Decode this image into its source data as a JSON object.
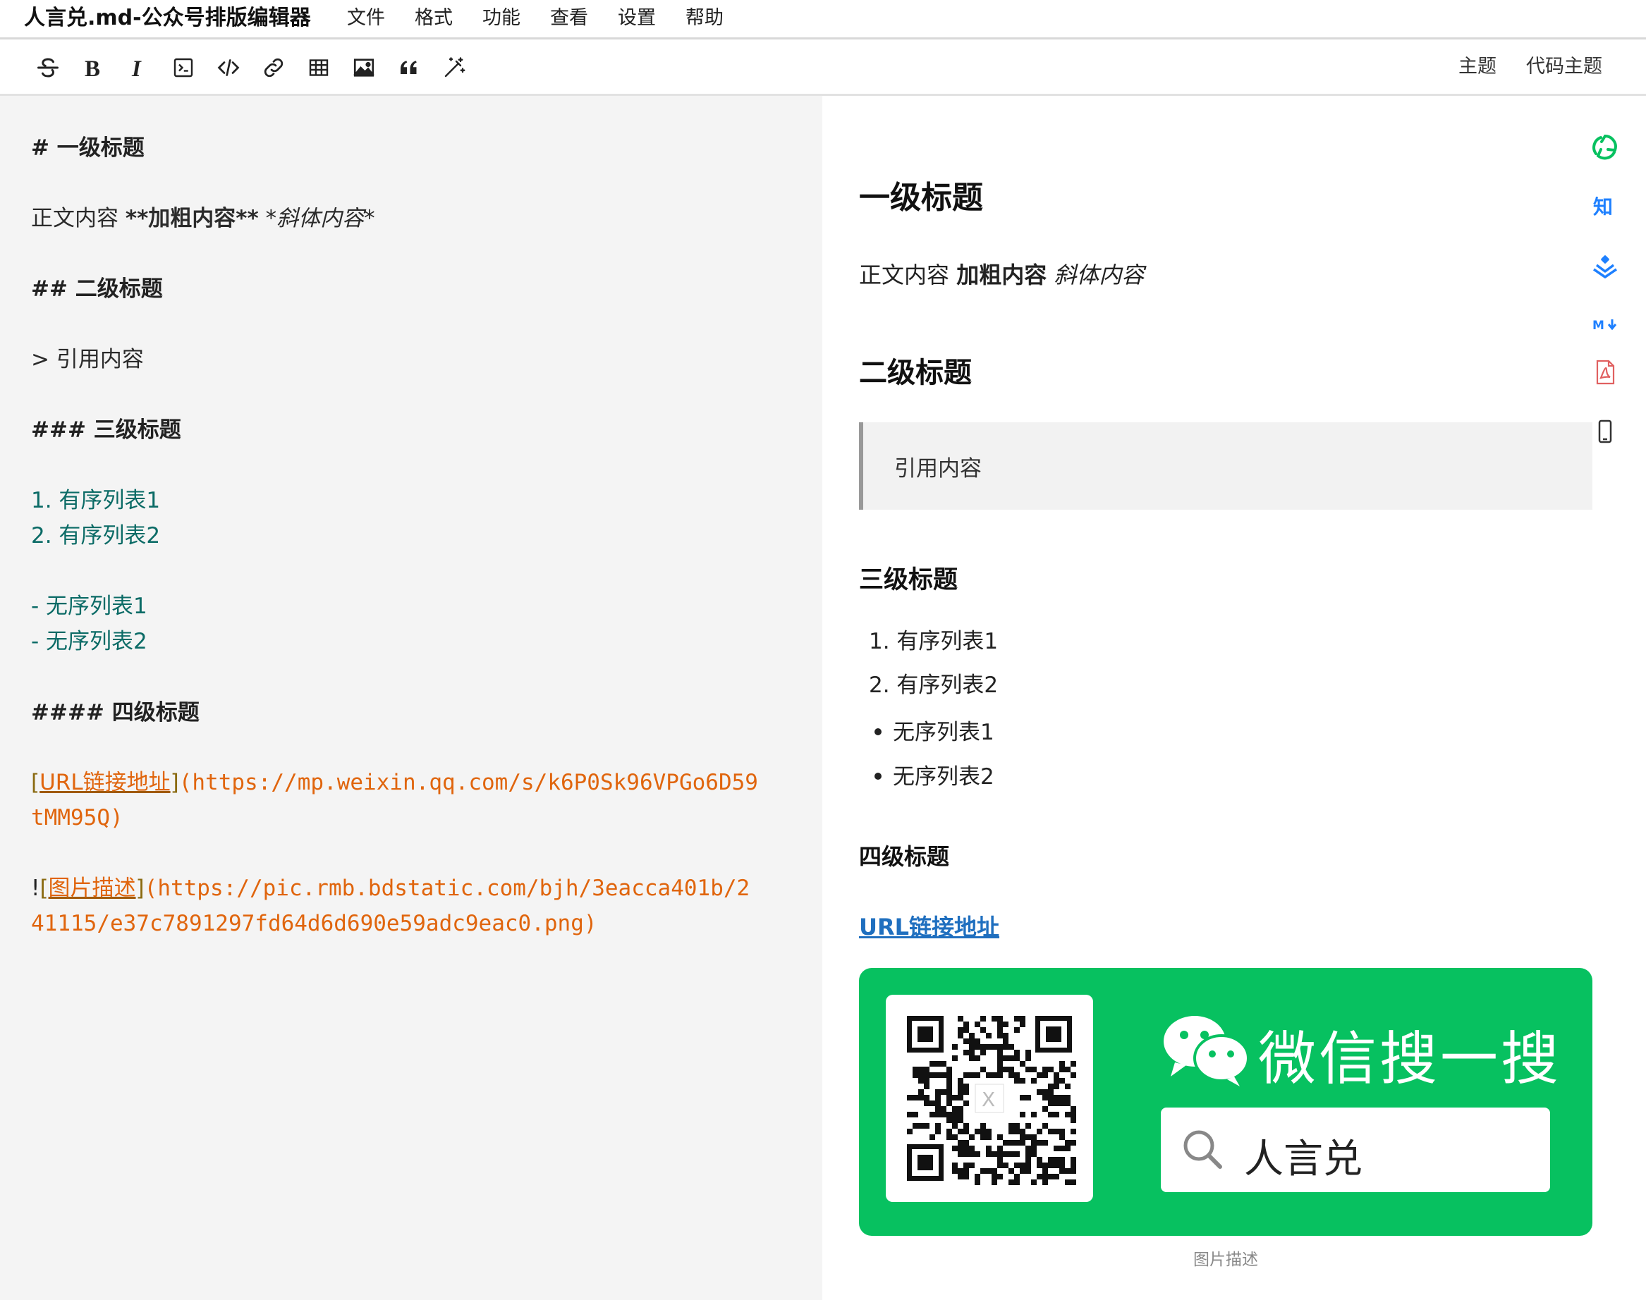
{
  "app": {
    "title": "人言兑.md-公众号排版编辑器"
  },
  "menu": {
    "items": [
      "文件",
      "格式",
      "功能",
      "查看",
      "设置",
      "帮助"
    ]
  },
  "toolbar": {
    "icons": [
      "strikethrough-icon",
      "bold-icon",
      "italic-icon",
      "inline-code-icon",
      "code-block-icon",
      "link-icon",
      "table-icon",
      "image-icon",
      "quote-icon",
      "magic-wand-icon"
    ],
    "theme_label": "主题",
    "code_theme_label": "代码主题"
  },
  "editor": {
    "h1": "#  一级标题",
    "para_plain": "正文内容 ",
    "para_bold": "**加粗内容**",
    "para_italic": " *斜体内容*",
    "h2": "##  二级标题",
    "quote": ">  引用内容",
    "h3": "###  三级标题",
    "ol1": "1.  有序列表1",
    "ol2": "2.  有序列表2",
    "ul1": "-  无序列表1",
    "ul2": "-  无序列表2",
    "h4": "####  四级标题",
    "link_open": "[",
    "link_text": "URL链接地址",
    "link_close": "]",
    "link_url_1": "(https://mp.weixin.qq.com/s/k6P0Sk96VPGo6D59",
    "link_url_2": "tMM95Q)",
    "img_bang": "!",
    "img_open": "[",
    "img_text": "图片描述",
    "img_close": "]",
    "img_url_1": "(https://pic.rmb.bdstatic.com/bjh/3eacca401b/2",
    "img_url_2": "41115/e37c7891297fd64d6d690e59adc9eac0.png)"
  },
  "preview": {
    "h1": "一级标题",
    "para_plain": "正文内容 ",
    "para_bold": "加粗内容",
    "para_italic": " 斜体内容",
    "h2": "二级标题",
    "quote": "引用内容",
    "h3": "三级标题",
    "ol": [
      "1. 有序列表1",
      "2. 有序列表2"
    ],
    "ul": [
      "无序列表1",
      "无序列表2"
    ],
    "h4": "四级标题",
    "link": "URL链接地址",
    "image": {
      "brand_text": "微信搜一搜",
      "search_text": "人言兑",
      "caption": "图片描述"
    }
  },
  "side_icons": [
    "wechat-moments-icon",
    "zhihu-icon",
    "juejin-icon",
    "markdown-download-icon",
    "pdf-icon",
    "mobile-preview-icon"
  ],
  "colors": {
    "wechat_green": "#07c160",
    "link_blue": "#1f6fbf",
    "editor_link_orange": "#e0650d",
    "editor_list_teal": "#0b6b66"
  }
}
